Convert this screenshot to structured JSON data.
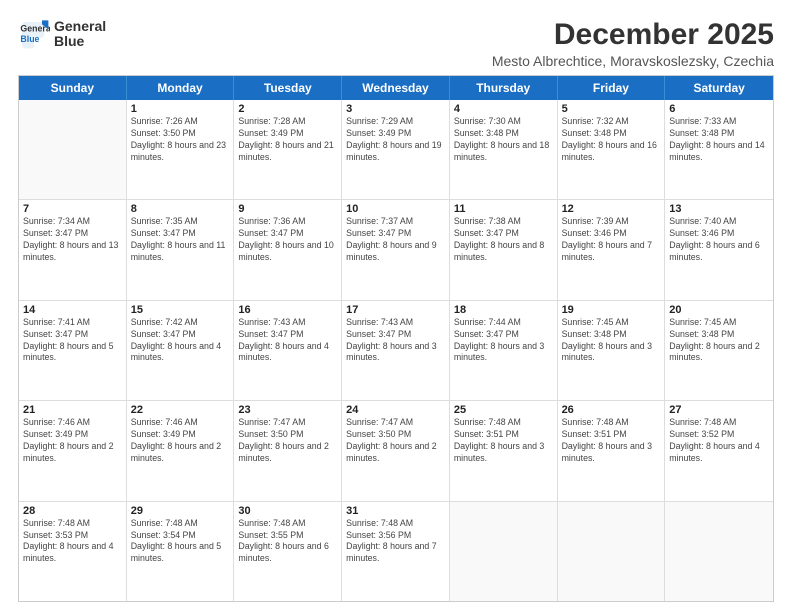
{
  "logo": {
    "line1": "General",
    "line2": "Blue"
  },
  "title": "December 2025",
  "location": "Mesto Albrechtice, Moravskoslezsky, Czechia",
  "days": [
    "Sunday",
    "Monday",
    "Tuesday",
    "Wednesday",
    "Thursday",
    "Friday",
    "Saturday"
  ],
  "weeks": [
    [
      {
        "day": "",
        "sunrise": "",
        "sunset": "",
        "daylight": ""
      },
      {
        "day": "1",
        "sunrise": "Sunrise: 7:26 AM",
        "sunset": "Sunset: 3:50 PM",
        "daylight": "Daylight: 8 hours and 23 minutes."
      },
      {
        "day": "2",
        "sunrise": "Sunrise: 7:28 AM",
        "sunset": "Sunset: 3:49 PM",
        "daylight": "Daylight: 8 hours and 21 minutes."
      },
      {
        "day": "3",
        "sunrise": "Sunrise: 7:29 AM",
        "sunset": "Sunset: 3:49 PM",
        "daylight": "Daylight: 8 hours and 19 minutes."
      },
      {
        "day": "4",
        "sunrise": "Sunrise: 7:30 AM",
        "sunset": "Sunset: 3:48 PM",
        "daylight": "Daylight: 8 hours and 18 minutes."
      },
      {
        "day": "5",
        "sunrise": "Sunrise: 7:32 AM",
        "sunset": "Sunset: 3:48 PM",
        "daylight": "Daylight: 8 hours and 16 minutes."
      },
      {
        "day": "6",
        "sunrise": "Sunrise: 7:33 AM",
        "sunset": "Sunset: 3:48 PM",
        "daylight": "Daylight: 8 hours and 14 minutes."
      }
    ],
    [
      {
        "day": "7",
        "sunrise": "Sunrise: 7:34 AM",
        "sunset": "Sunset: 3:47 PM",
        "daylight": "Daylight: 8 hours and 13 minutes."
      },
      {
        "day": "8",
        "sunrise": "Sunrise: 7:35 AM",
        "sunset": "Sunset: 3:47 PM",
        "daylight": "Daylight: 8 hours and 11 minutes."
      },
      {
        "day": "9",
        "sunrise": "Sunrise: 7:36 AM",
        "sunset": "Sunset: 3:47 PM",
        "daylight": "Daylight: 8 hours and 10 minutes."
      },
      {
        "day": "10",
        "sunrise": "Sunrise: 7:37 AM",
        "sunset": "Sunset: 3:47 PM",
        "daylight": "Daylight: 8 hours and 9 minutes."
      },
      {
        "day": "11",
        "sunrise": "Sunrise: 7:38 AM",
        "sunset": "Sunset: 3:47 PM",
        "daylight": "Daylight: 8 hours and 8 minutes."
      },
      {
        "day": "12",
        "sunrise": "Sunrise: 7:39 AM",
        "sunset": "Sunset: 3:46 PM",
        "daylight": "Daylight: 8 hours and 7 minutes."
      },
      {
        "day": "13",
        "sunrise": "Sunrise: 7:40 AM",
        "sunset": "Sunset: 3:46 PM",
        "daylight": "Daylight: 8 hours and 6 minutes."
      }
    ],
    [
      {
        "day": "14",
        "sunrise": "Sunrise: 7:41 AM",
        "sunset": "Sunset: 3:47 PM",
        "daylight": "Daylight: 8 hours and 5 minutes."
      },
      {
        "day": "15",
        "sunrise": "Sunrise: 7:42 AM",
        "sunset": "Sunset: 3:47 PM",
        "daylight": "Daylight: 8 hours and 4 minutes."
      },
      {
        "day": "16",
        "sunrise": "Sunrise: 7:43 AM",
        "sunset": "Sunset: 3:47 PM",
        "daylight": "Daylight: 8 hours and 4 minutes."
      },
      {
        "day": "17",
        "sunrise": "Sunrise: 7:43 AM",
        "sunset": "Sunset: 3:47 PM",
        "daylight": "Daylight: 8 hours and 3 minutes."
      },
      {
        "day": "18",
        "sunrise": "Sunrise: 7:44 AM",
        "sunset": "Sunset: 3:47 PM",
        "daylight": "Daylight: 8 hours and 3 minutes."
      },
      {
        "day": "19",
        "sunrise": "Sunrise: 7:45 AM",
        "sunset": "Sunset: 3:48 PM",
        "daylight": "Daylight: 8 hours and 3 minutes."
      },
      {
        "day": "20",
        "sunrise": "Sunrise: 7:45 AM",
        "sunset": "Sunset: 3:48 PM",
        "daylight": "Daylight: 8 hours and 2 minutes."
      }
    ],
    [
      {
        "day": "21",
        "sunrise": "Sunrise: 7:46 AM",
        "sunset": "Sunset: 3:49 PM",
        "daylight": "Daylight: 8 hours and 2 minutes."
      },
      {
        "day": "22",
        "sunrise": "Sunrise: 7:46 AM",
        "sunset": "Sunset: 3:49 PM",
        "daylight": "Daylight: 8 hours and 2 minutes."
      },
      {
        "day": "23",
        "sunrise": "Sunrise: 7:47 AM",
        "sunset": "Sunset: 3:50 PM",
        "daylight": "Daylight: 8 hours and 2 minutes."
      },
      {
        "day": "24",
        "sunrise": "Sunrise: 7:47 AM",
        "sunset": "Sunset: 3:50 PM",
        "daylight": "Daylight: 8 hours and 2 minutes."
      },
      {
        "day": "25",
        "sunrise": "Sunrise: 7:48 AM",
        "sunset": "Sunset: 3:51 PM",
        "daylight": "Daylight: 8 hours and 3 minutes."
      },
      {
        "day": "26",
        "sunrise": "Sunrise: 7:48 AM",
        "sunset": "Sunset: 3:51 PM",
        "daylight": "Daylight: 8 hours and 3 minutes."
      },
      {
        "day": "27",
        "sunrise": "Sunrise: 7:48 AM",
        "sunset": "Sunset: 3:52 PM",
        "daylight": "Daylight: 8 hours and 4 minutes."
      }
    ],
    [
      {
        "day": "28",
        "sunrise": "Sunrise: 7:48 AM",
        "sunset": "Sunset: 3:53 PM",
        "daylight": "Daylight: 8 hours and 4 minutes."
      },
      {
        "day": "29",
        "sunrise": "Sunrise: 7:48 AM",
        "sunset": "Sunset: 3:54 PM",
        "daylight": "Daylight: 8 hours and 5 minutes."
      },
      {
        "day": "30",
        "sunrise": "Sunrise: 7:48 AM",
        "sunset": "Sunset: 3:55 PM",
        "daylight": "Daylight: 8 hours and 6 minutes."
      },
      {
        "day": "31",
        "sunrise": "Sunrise: 7:48 AM",
        "sunset": "Sunset: 3:56 PM",
        "daylight": "Daylight: 8 hours and 7 minutes."
      },
      {
        "day": "",
        "sunrise": "",
        "sunset": "",
        "daylight": ""
      },
      {
        "day": "",
        "sunrise": "",
        "sunset": "",
        "daylight": ""
      },
      {
        "day": "",
        "sunrise": "",
        "sunset": "",
        "daylight": ""
      }
    ]
  ]
}
